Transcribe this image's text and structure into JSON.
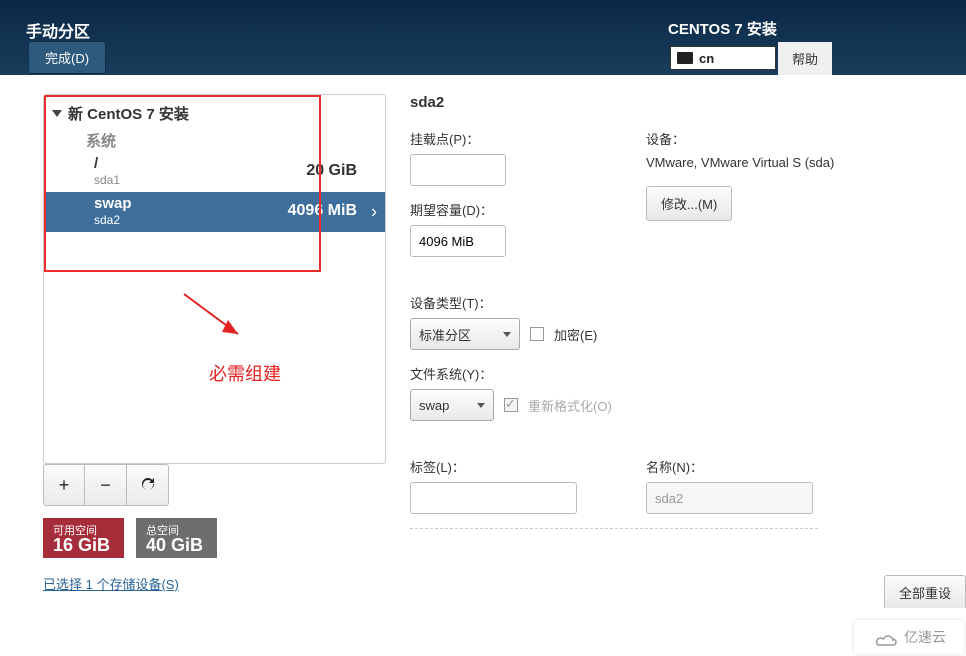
{
  "header": {
    "title": "手动分区",
    "done": "完成(D)",
    "installer": "CENTOS 7 安装",
    "kbd": "cn",
    "help": "帮助"
  },
  "left": {
    "install_heading": "新 CentOS 7 安装",
    "category_system": "系统",
    "partitions": [
      {
        "name": "/",
        "dev": "sda1",
        "size": "20 GiB",
        "selected": false
      },
      {
        "name": "swap",
        "dev": "sda2",
        "size": "4096 MiB",
        "selected": true
      }
    ],
    "annotation_text": "必需组建",
    "free_label": "可用空间",
    "free_value": "16 GiB",
    "total_label": "总空间",
    "total_value": "40 GiB",
    "selected_devices": "已选择 1 个存储设备(S)"
  },
  "right": {
    "title": "sda2",
    "mount_label": "挂载点(P)：",
    "mount_value": "",
    "desired_label": "期望容量(D)：",
    "desired_value": "4096 MiB",
    "device_label": "设备：",
    "device_text": "VMware, VMware Virtual S (sda)",
    "modify": "修改...(M)",
    "devtype_label": "设备类型(T)：",
    "devtype_value": "标准分区",
    "encrypt_label": "加密(E)",
    "fs_label": "文件系统(Y)：",
    "fs_value": "swap",
    "reformat_label": "重新格式化(O)",
    "label_label": "标签(L)：",
    "label_value": "",
    "name_label": "名称(N)：",
    "name_value": "sda2",
    "reset": "全部重设"
  },
  "watermark": "亿速云"
}
